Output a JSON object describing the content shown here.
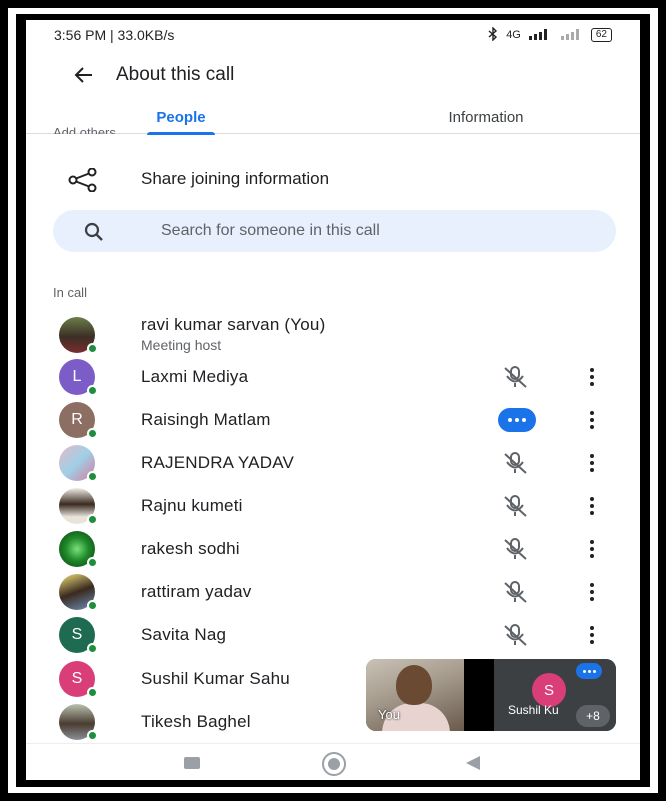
{
  "status_bar": {
    "time_speed": "3:56 PM | 33.0KB/s",
    "network_text": "4G",
    "battery": "62"
  },
  "header": {
    "title": "About this call"
  },
  "tabs": [
    {
      "label": "People",
      "active": true
    },
    {
      "label": "Information",
      "active": false
    }
  ],
  "add_others_label": "Add others",
  "share": {
    "label": "Share joining information"
  },
  "search": {
    "placeholder": "Search for someone in this call"
  },
  "section": {
    "in_call_label": "In call"
  },
  "participants": [
    {
      "name": "ravi kumar sarvan (You)",
      "subtitle": "Meeting host",
      "avatar_type": "photo",
      "status": "none"
    },
    {
      "name": "Laxmi Mediya",
      "initial": "L",
      "avatar_color": "#7c5dc7",
      "status": "muted"
    },
    {
      "name": "Raisingh Matlam",
      "initial": "R",
      "avatar_color": "#8d6e63",
      "status": "speaking"
    },
    {
      "name": "RAJENDRA YADAV",
      "avatar_type": "photo",
      "status": "muted"
    },
    {
      "name": "Rajnu kumeti",
      "avatar_type": "photo",
      "status": "muted"
    },
    {
      "name": "rakesh sodhi",
      "avatar_type": "photo",
      "status": "muted"
    },
    {
      "name": "rattiram yadav",
      "avatar_type": "photo",
      "status": "muted"
    },
    {
      "name": "Savita Nag",
      "initial": "S",
      "avatar_color": "#1e6b52",
      "status": "muted"
    },
    {
      "name": "Sushil Kumar Sahu",
      "initial": "S",
      "avatar_color": "#d93e78",
      "status": "muted"
    },
    {
      "name": "Tikesh Baghel",
      "avatar_type": "photo",
      "status": "muted"
    }
  ],
  "video_tile": {
    "self_label": "You",
    "remote_initial": "S",
    "remote_label": "Sushil Ku",
    "extra_count": "+8"
  },
  "colors": {
    "accent": "#1a73e8",
    "online": "#1e8e3e"
  }
}
